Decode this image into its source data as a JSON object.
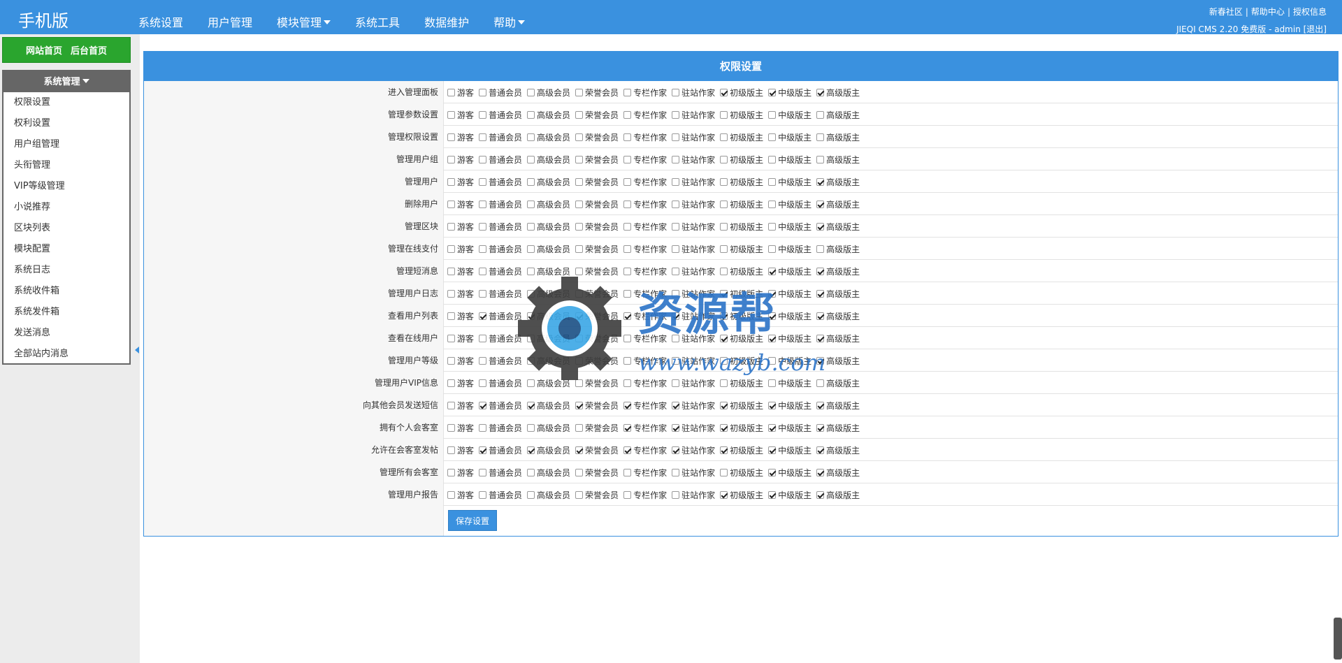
{
  "brand": "手机版",
  "nav": [
    {
      "label": "系统设置",
      "dropdown": false
    },
    {
      "label": "用户管理",
      "dropdown": false
    },
    {
      "label": "模块管理",
      "dropdown": true
    },
    {
      "label": "系统工具",
      "dropdown": false
    },
    {
      "label": "数据维护",
      "dropdown": false
    },
    {
      "label": "帮助",
      "dropdown": true
    }
  ],
  "top_links": [
    "新春社区",
    "帮助中心",
    "授权信息"
  ],
  "top_info": "JIEQI CMS 2.20 免费版 - admin [退出]",
  "home_links": [
    "网站首页",
    "后台首页"
  ],
  "sidebar_title": "系统管理",
  "sidebar_items": [
    "权限设置",
    "权利设置",
    "用户组管理",
    "头衔管理",
    "VIP等级管理",
    "小说推荐",
    "区块列表",
    "模块配置",
    "系统日志",
    "系统收件箱",
    "系统发件箱",
    "发送消息",
    "全部站内消息"
  ],
  "panel_title": "权限设置",
  "groups": [
    "游客",
    "普通会员",
    "高级会员",
    "荣誉会员",
    "专栏作家",
    "驻站作家",
    "初级版主",
    "中级版主",
    "高级版主"
  ],
  "permissions": [
    {
      "label": "进入管理面板",
      "checked": [
        0,
        0,
        0,
        0,
        0,
        0,
        1,
        1,
        1
      ]
    },
    {
      "label": "管理参数设置",
      "checked": [
        0,
        0,
        0,
        0,
        0,
        0,
        0,
        0,
        0
      ]
    },
    {
      "label": "管理权限设置",
      "checked": [
        0,
        0,
        0,
        0,
        0,
        0,
        0,
        0,
        0
      ]
    },
    {
      "label": "管理用户组",
      "checked": [
        0,
        0,
        0,
        0,
        0,
        0,
        0,
        0,
        0
      ]
    },
    {
      "label": "管理用户",
      "checked": [
        0,
        0,
        0,
        0,
        0,
        0,
        0,
        0,
        1
      ]
    },
    {
      "label": "删除用户",
      "checked": [
        0,
        0,
        0,
        0,
        0,
        0,
        0,
        0,
        1
      ]
    },
    {
      "label": "管理区块",
      "checked": [
        0,
        0,
        0,
        0,
        0,
        0,
        0,
        0,
        1
      ]
    },
    {
      "label": "管理在线支付",
      "checked": [
        0,
        0,
        0,
        0,
        0,
        0,
        0,
        0,
        0
      ]
    },
    {
      "label": "管理短消息",
      "checked": [
        0,
        0,
        0,
        0,
        0,
        0,
        0,
        1,
        1
      ]
    },
    {
      "label": "管理用户日志",
      "checked": [
        0,
        0,
        0,
        0,
        0,
        0,
        1,
        1,
        1
      ]
    },
    {
      "label": "查看用户列表",
      "checked": [
        0,
        1,
        1,
        1,
        1,
        1,
        1,
        1,
        1
      ]
    },
    {
      "label": "查看在线用户",
      "checked": [
        0,
        0,
        0,
        0,
        0,
        0,
        1,
        1,
        1
      ]
    },
    {
      "label": "管理用户等级",
      "checked": [
        0,
        0,
        0,
        0,
        0,
        0,
        0,
        0,
        1
      ]
    },
    {
      "label": "管理用户VIP信息",
      "checked": [
        0,
        0,
        0,
        0,
        0,
        0,
        0,
        0,
        0
      ]
    },
    {
      "label": "向其他会员发送短信",
      "checked": [
        0,
        1,
        1,
        1,
        1,
        1,
        1,
        1,
        1
      ]
    },
    {
      "label": "拥有个人会客室",
      "checked": [
        0,
        0,
        0,
        0,
        1,
        1,
        1,
        1,
        1
      ]
    },
    {
      "label": "允许在会客室发帖",
      "checked": [
        0,
        1,
        1,
        1,
        1,
        1,
        1,
        1,
        1
      ]
    },
    {
      "label": "管理所有会客室",
      "checked": [
        0,
        0,
        0,
        0,
        0,
        0,
        0,
        1,
        1
      ]
    },
    {
      "label": "管理用户报告",
      "checked": [
        0,
        0,
        0,
        0,
        0,
        0,
        1,
        1,
        1
      ]
    }
  ],
  "save_label": "保存设置",
  "watermark": {
    "title": "资源帮",
    "url": "www.wazyb.com"
  },
  "colors": {
    "primary": "#3a91df",
    "home_green": "#2aa52e",
    "sidebar_head": "#666666"
  }
}
